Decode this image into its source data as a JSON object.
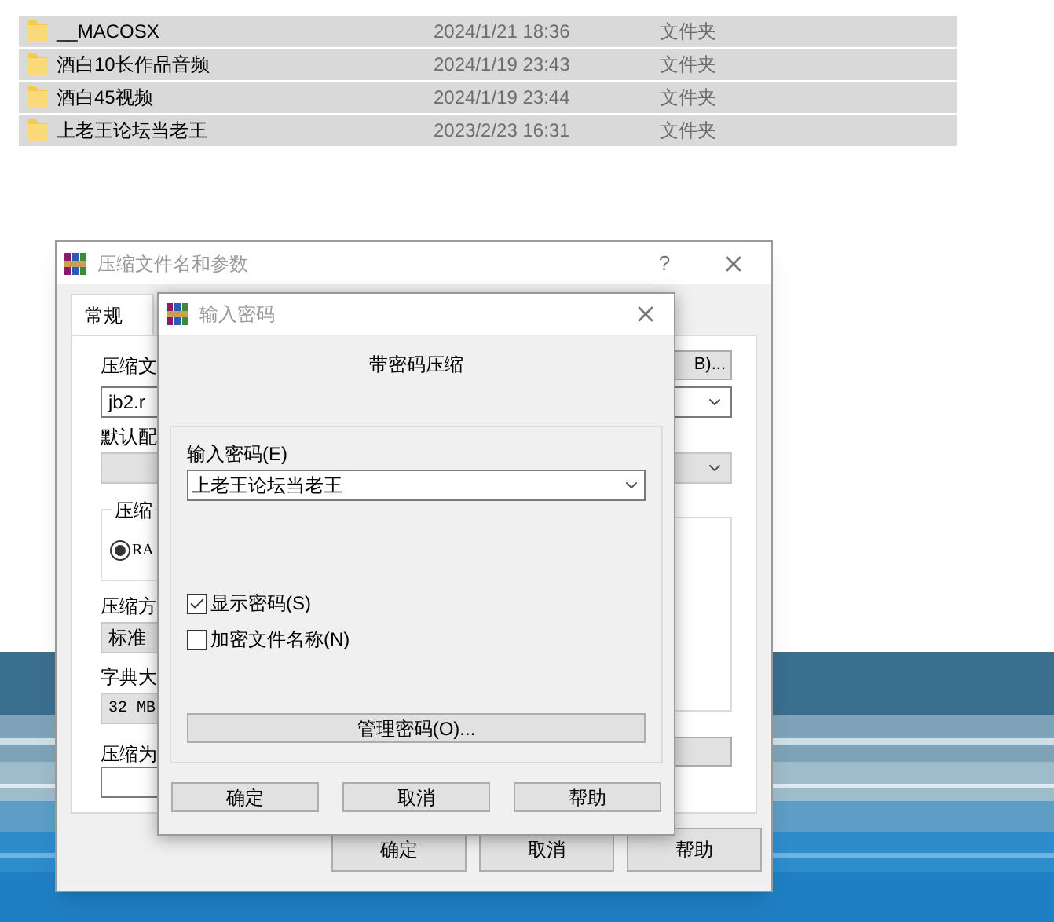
{
  "explorer": {
    "rows": [
      {
        "name": "__MACOSX",
        "date": "2024/1/21 18:36",
        "type": "文件夹",
        "selected": true
      },
      {
        "name": "酒白10长作品音频",
        "date": "2024/1/19 23:43",
        "type": "文件夹",
        "selected": true
      },
      {
        "name": "酒白45视频",
        "date": "2024/1/19 23:44",
        "type": "文件夹",
        "selected": true
      },
      {
        "name": "上老王论坛当老王",
        "date": "2023/2/23 16:31",
        "type": "文件夹",
        "selected": true
      }
    ]
  },
  "archive_dialog": {
    "title": "压缩文件名和参数",
    "help": "?",
    "tabs": [
      {
        "label": "常规",
        "selected": true
      }
    ],
    "archive_name_label": "压缩文",
    "browse_button": "B)...",
    "archive_name": "jb2.r",
    "profile_label": "默认配",
    "format_group_label": "压缩",
    "format_option": {
      "label": "RA",
      "selected": true
    },
    "method_label": "压缩方",
    "method": "标准",
    "dictionary_label": "字典大",
    "dictionary": "32 MB",
    "split_label": "压缩为",
    "buttons": [
      "确定",
      "取消",
      "帮助"
    ]
  },
  "password_dialog": {
    "title": "输入密码",
    "heading": "带密码压缩",
    "password_label": "输入密码(E)",
    "password": "上老王论坛当老王",
    "options": [
      {
        "label": "显示密码(S)",
        "checked": true
      },
      {
        "label": "加密文件名称(N)",
        "checked": false
      }
    ],
    "manage_button": "管理密码(O)...",
    "buttons": [
      "确定",
      "取消",
      "帮助"
    ]
  }
}
